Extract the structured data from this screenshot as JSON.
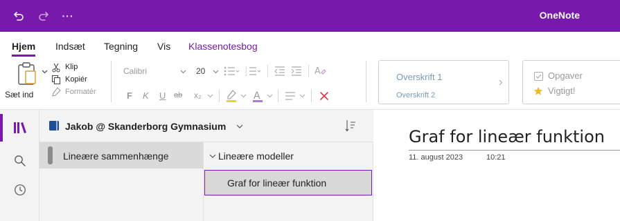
{
  "app": {
    "name": "OneNote"
  },
  "title_bar": {
    "undo_icon": "undo-icon",
    "redo_icon": "redo-icon",
    "more_label": "···"
  },
  "ribbon": {
    "tabs": [
      {
        "label": "Hjem",
        "active": true
      },
      {
        "label": "Indsæt"
      },
      {
        "label": "Tegning"
      },
      {
        "label": "Vis"
      },
      {
        "label": "Klassenotesbog",
        "accent": true
      }
    ]
  },
  "toolbar": {
    "paste_label": "Sæt ind",
    "cut_label": "Klip",
    "copy_label": "Kopiér",
    "format_painter_label": "Formatér",
    "font_name": "Calibri",
    "font_size": "20",
    "bold_label": "F",
    "italic_label": "K",
    "underline_label": "U",
    "strike_label": "ab",
    "subscript_label": "x₂",
    "styles": {
      "heading1": "Overskrift 1",
      "heading2": "Overskrift 2"
    },
    "tags": {
      "todo_label": "Opgaver",
      "important_label": "Vigtigt!"
    }
  },
  "notebook": {
    "name": "Jakob @ Skanderborg Gymnasium",
    "sections": [
      {
        "label": "Lineære sammenhænge",
        "selected": true
      }
    ],
    "section_group": "Lineære modeller",
    "pages": [
      {
        "label": "Graf for lineær funktion",
        "selected": true
      }
    ]
  },
  "page": {
    "title": "Graf for lineær funktion",
    "date": "11. august 2023",
    "time": "10:21"
  },
  "colors": {
    "accent": "#7719aa",
    "star": "#f2b824",
    "delete": "#e0383e"
  }
}
